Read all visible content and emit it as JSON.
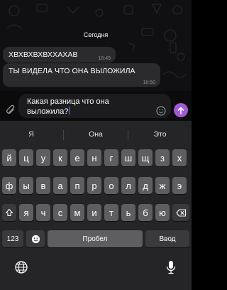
{
  "chat": {
    "date_label": "Сегодня",
    "messages": [
      {
        "text": "ХВХВХВХВХХАХАВ",
        "time": "16:49"
      },
      {
        "text": "ТЫ ВИДЕЛА ЧТО ОНА ВЫЛОЖИЛА",
        "time": "16:50"
      }
    ]
  },
  "composer": {
    "text_line1": "Какая разница что она",
    "text_line2": "выложила?",
    "attach_icon": "paperclip-icon",
    "emoji_icon": "emoji-icon",
    "send_icon": "send-arrow-icon",
    "send_color": "#a05ad6"
  },
  "suggestions": [
    "Я",
    "Она",
    "Это"
  ],
  "keyboard": {
    "row1": [
      "й",
      "ц",
      "у",
      "к",
      "е",
      "н",
      "г",
      "ш",
      "щ",
      "з",
      "х"
    ],
    "row2": [
      "ф",
      "ы",
      "в",
      "а",
      "п",
      "р",
      "о",
      "л",
      "д",
      "ж",
      "э"
    ],
    "row3": [
      "я",
      "ч",
      "с",
      "м",
      "и",
      "т",
      "ь",
      "б",
      "ю"
    ],
    "numbers_label": "123",
    "space_label": "Пробел",
    "return_label": "Ввод",
    "shift_icon": "shift-icon",
    "backspace_icon": "backspace-icon",
    "emoji_key_icon": "emoji-icon",
    "globe_icon": "globe-icon",
    "mic_icon": "microphone-icon"
  }
}
